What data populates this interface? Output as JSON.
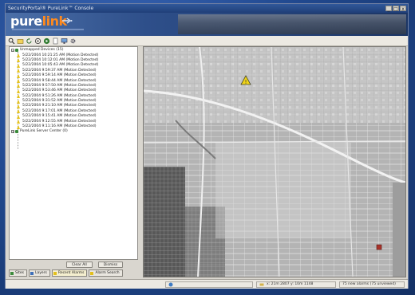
{
  "window": {
    "title": "SecurityPortal® PureLink™ Console",
    "controls": [
      "_",
      "□",
      "x"
    ]
  },
  "brand": {
    "logo_left": "pure",
    "logo_right": "link",
    "colors": {
      "accent": "#ff8a1e",
      "banner": "#2e4f8a"
    }
  },
  "toolbar": {
    "icons": [
      "search-icon",
      "folder-icon",
      "refresh-icon",
      "target-icon",
      "play-icon",
      "document-icon",
      "monitor-icon",
      "settings-icon"
    ]
  },
  "tree": {
    "root_label": "Unmapped Devices (15)",
    "alarms": [
      "5/22/2004 10:21:25 AM (Motion Detected)",
      "5/22/2004 10:12:01 AM (Motion Detected)",
      "5/22/2004 10:05:43 AM (Motion Detected)",
      "5/22/2004 9:59:37 AM (Motion Detected)",
      "5/22/2004 9:59:14 AM (Motion Detected)",
      "5/22/2004 9:58:44 AM (Motion Detected)",
      "5/22/2004 9:57:50 AM (Motion Detected)",
      "5/22/2004 9:53:46 AM (Motion Detected)",
      "5/22/2004 9:51:26 AM (Motion Detected)",
      "5/22/2004 9:31:52 AM (Motion Detected)",
      "5/22/2004 9:21:10 AM (Motion Detected)",
      "5/22/2004 9:17:01 AM (Motion Detected)",
      "5/22/2004 9:15:41 AM (Motion Detected)",
      "5/22/2004 9:12:55 AM (Motion Detected)",
      "5/22/2004 9:11:16 AM (Motion Detected)"
    ],
    "server_label": "PureLink Server Center (0)"
  },
  "panel_buttons": {
    "clear_all": "Clear All",
    "dismiss": "Dismiss"
  },
  "tabs": [
    "Sites",
    "Layers",
    "Recent Alarms",
    "Alarm Search"
  ],
  "map": {
    "markers": [
      {
        "type": "alarm",
        "color": "#f0d418"
      },
      {
        "type": "site",
        "color": "#a8322a"
      }
    ]
  },
  "status": {
    "coords": "x: 21m 2807  y: 10m 1148",
    "count": "75 new alarms (75 unviewed)"
  }
}
